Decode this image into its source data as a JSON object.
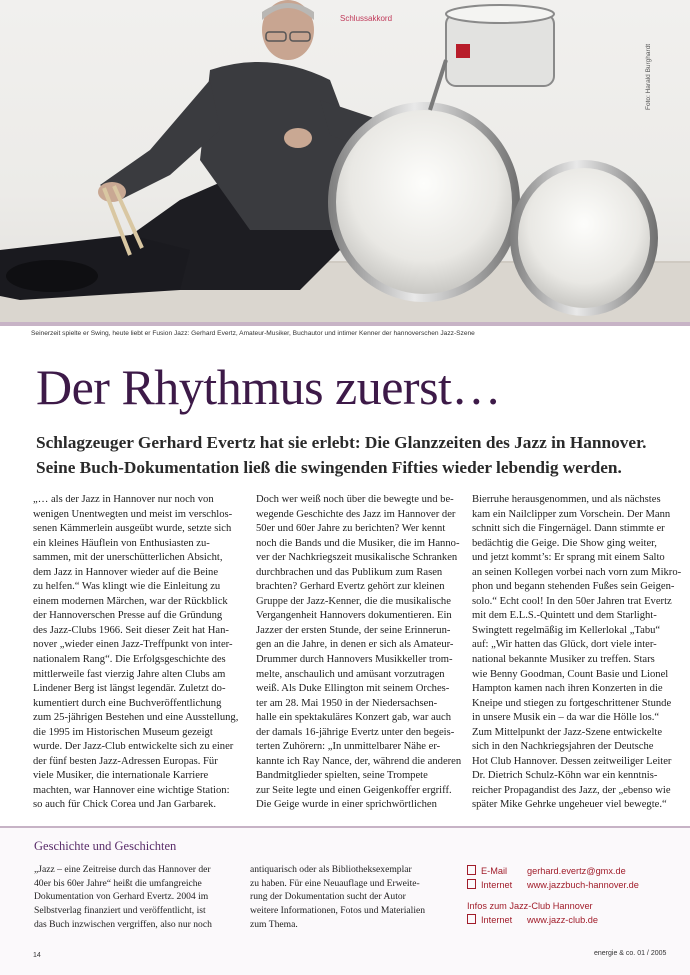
{
  "photo": {
    "kicker": "Schlussakkord",
    "credit": "Foto: Harald Burghardt"
  },
  "caption": "Seinerzeit spielte er Swing, heute liebt er Fusion Jazz: Gerhard Evertz, Amateur-Musiker, Buchautor und intimer Kenner der hannoverschen Jazz-Szene",
  "title": "Der Rhythmus zuerst…",
  "subtitle": [
    "Schlagzeuger Gerhard Evertz hat sie erlebt: Die Glanzzeiten des Jazz in Hannover.",
    "Seine Buch-Dokumentation ließ die swingenden Fifties wieder lebendig werden."
  ],
  "columns": [
    [
      "„… als der Jazz in Hannover nur noch von",
      "wenigen Unentwegten und meist im verschlos-",
      "senen Kämmerlein ausgeübt wurde, setzte sich",
      "ein kleines Häuflein von Enthusiasten zu-",
      "sammen, mit der unerschütterlichen Absicht,",
      "dem Jazz in Hannover wieder auf die Beine",
      "zu helfen.“ Was klingt wie die Einleitung zu",
      "einem modernen Märchen, war der Rückblick",
      "der Hannoverschen Presse auf die Gründung",
      "des Jazz-Clubs 1966. Seit dieser Zeit hat Han-",
      "nover „wieder einen Jazz-Treffpunkt von inter-",
      "nationalem Rang“. Die Erfolgsgeschichte des",
      "mittlerweile fast vierzig Jahre alten Clubs am",
      "Lindener Berg ist längst legendär. Zuletzt do-",
      "kumentiert durch eine Buchveröffentlichung",
      "zum 25-jährigen Bestehen und eine Ausstellung,",
      "die 1995 im Historischen Museum gezeigt",
      "wurde. Der Jazz-Club entwickelte sich zu einer",
      "der fünf besten Jazz-Adressen Europas. Für",
      "viele Musiker, die internationale Karriere",
      "machten, war Hannover eine wichtige Station:",
      "so auch für Chick Corea und Jan Garbarek."
    ],
    [
      "Doch wer weiß noch über die bewegte und be-",
      "wegende Geschichte des Jazz im Hannover der",
      "50er und 60er Jahre zu berichten? Wer kennt",
      "noch die Bands und die Musiker, die im Hanno-",
      "ver der Nachkriegszeit musikalische Schranken",
      "durchbrachen und das Publikum zum Rasen",
      "brachten? Gerhard Evertz gehört zur kleinen",
      "Gruppe der Jazz-Kenner, die die musikalische",
      "Vergangenheit Hannovers dokumentieren. Ein",
      "Jazzer der ersten Stunde, der seine Erinnerun-",
      "gen an die Jahre, in denen er sich als Amateur-",
      "Drummer durch Hannovers Musikkeller trom-",
      "melte, anschaulich und amüsant vorzutragen",
      "weiß. Als Duke Ellington mit seinem Orches-",
      "ter am 28. Mai 1950 in der Niedersachsen-",
      "halle ein spektakuläres Konzert gab, war auch",
      "der damals 16-jährige Evertz unter den begeis-",
      "terten Zuhörern: „In unmittelbarer Nähe er-",
      "kannte ich Ray Nance, der, während die anderen",
      "Bandmitglieder spielten, seine Trompete",
      "zur Seite legte und einen Geigenkoffer ergriff.",
      "Die Geige wurde in einer sprichwörtlichen"
    ],
    [
      "Bierruhe herausgenommen, und als nächstes",
      "kam ein Nailclipper zum Vorschein. Der Mann",
      "schnitt sich die Fingernägel. Dann stimmte er",
      "bedächtig die Geige. Die Show ging weiter,",
      "und jetzt kommt’s: Er sprang mit einem Salto",
      "an seinen Kollegen vorbei nach vorn zum Mikro-",
      "phon und begann stehenden Fußes sein Geigen-",
      "solo.“ Echt cool! In den 50er Jahren trat Evertz",
      "mit dem E.L.S.-Quintett und dem Starlight-",
      "Swingtett regelmäßig im Kellerlokal „Tabu“",
      "auf: „Wir hatten das Glück, dort viele inter-",
      "national bekannte Musiker zu treffen. Stars",
      "wie Benny Goodman, Count Basie und Lionel",
      "Hampton kamen nach ihren Konzerten in die",
      "Kneipe und stiegen zu fortgeschrittener Stunde",
      "in unsere Musik ein – da war die Hölle los.“",
      "Zum Mittelpunkt der Jazz-Szene entwickelte",
      "sich in den Nachkriegsjahren der Deutsche",
      "Hot Club Hannover. Dessen zeitweiliger Leiter",
      "Dr. Dietrich Schulz-Köhn war ein kenntnis-",
      "reicher Propagandist des Jazz, der „ebenso wie",
      "später Mike Gehrke ungeheuer viel bewegte.“"
    ]
  ],
  "box": {
    "title": "Geschichte und Geschichten",
    "col1": [
      "„Jazz – eine Zeitreise durch das Hannover der",
      "40er bis 60er Jahre“ heißt die umfangreiche",
      "Dokumentation von Gerhard Evertz. 2004 im",
      "Selbstverlag finanziert und veröffentlicht, ist",
      "das Buch inzwischen vergriffen, also nur noch"
    ],
    "col2": [
      "antiquarisch oder als Bibliotheksexemplar",
      "zu haben. Für eine Neuauflage und Erweite-",
      "rung der Dokumentation sucht der Autor",
      "weitere Informationen, Fotos und Materialien",
      "zum Thema."
    ],
    "email_label": "E-Mail",
    "email": "gerhard.evertz@gmx.de",
    "internet_label": "Internet",
    "internet": "www.jazzbuch-hannover.de",
    "info_heading": "Infos zum Jazz-Club Hannover",
    "internet2_label": "Internet",
    "internet2": "www.jazz-club.de"
  },
  "footer": {
    "page": "14",
    "issue": "energie & co. 01 / 2005"
  }
}
